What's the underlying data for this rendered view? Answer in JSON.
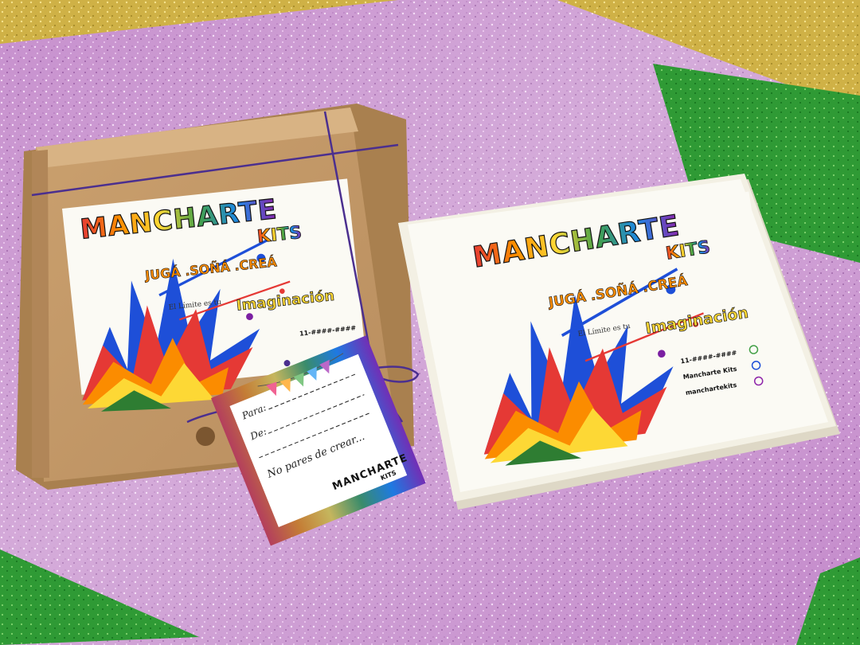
{
  "brand": {
    "name": "MANCHARTE",
    "sub": "KITS"
  },
  "slogan": "JUGÁ .SOÑÁ .CREÁ",
  "limit_text": "El Límite es tu",
  "imagination": "Imaginación",
  "contacts": [
    {
      "icon": "whatsapp-icon",
      "text": "11-####-####"
    },
    {
      "icon": "facebook-icon",
      "text": "Mancharte Kits"
    },
    {
      "icon": "instagram-icon",
      "text": "manchartekits"
    }
  ],
  "tag": {
    "from_label": "Para:",
    "to_label": "De:",
    "message": "No pares de crear...",
    "brand": "MANCHARTE",
    "brand_sub": "KITS"
  },
  "colors": {
    "purple_glitter": "#c98bd0",
    "gold_glitter": "#d8bb48",
    "green_glitter": "#2c9a34",
    "kraft": "#c49a6c",
    "twine": "#4b2f8f",
    "card": "#fbfaf4"
  }
}
